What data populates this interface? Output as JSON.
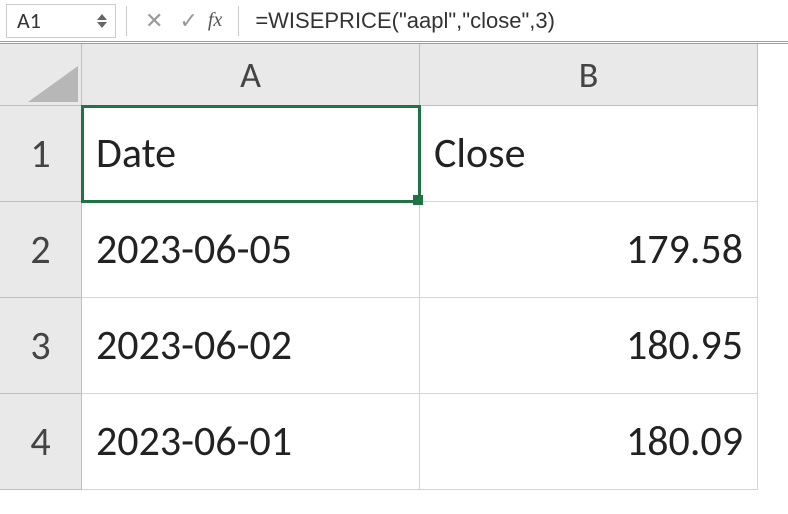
{
  "formula_bar": {
    "name_box": "A1",
    "fx_label": "fx",
    "formula": "=WISEPRICE(\"aapl\",\"close\",3)"
  },
  "columns": {
    "a": "A",
    "b": "B"
  },
  "rows": [
    {
      "num": "1",
      "a": "Date",
      "b": "Close",
      "b_is_text": true
    },
    {
      "num": "2",
      "a": "2023-06-05",
      "b": "179.58",
      "b_is_text": false
    },
    {
      "num": "3",
      "a": "2023-06-02",
      "b": "180.95",
      "b_is_text": false
    },
    {
      "num": "4",
      "a": "2023-06-01",
      "b": "180.09",
      "b_is_text": false
    }
  ],
  "selected": {
    "row": 0,
    "col": "a"
  }
}
